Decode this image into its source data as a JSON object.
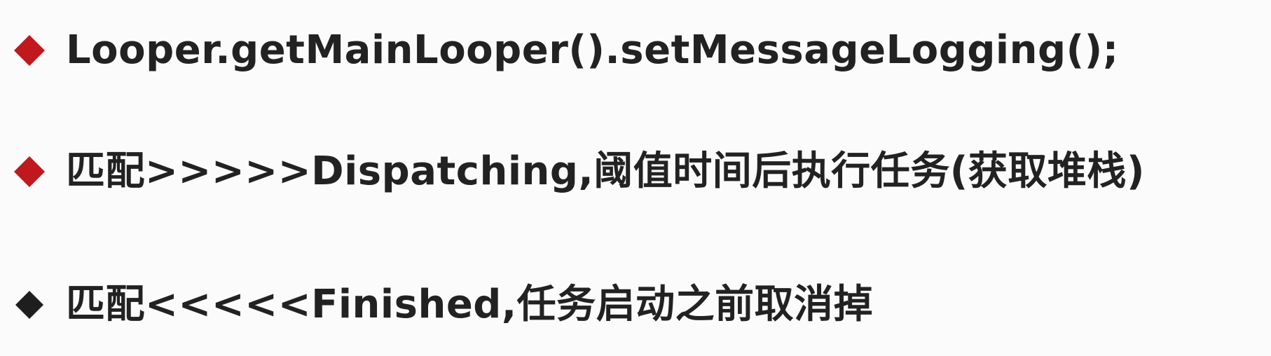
{
  "bullets": [
    {
      "text": "Looper.getMainLooper().setMessageLogging();",
      "marker_color": "#c0181c"
    },
    {
      "text": "匹配>>>>>Dispatching,阈值时间后执行任务(获取堆栈)",
      "marker_color": "#c0181c"
    },
    {
      "text": "匹配<<<<<Finished,任务启动之前取消掉",
      "marker_color": "#1e1e1e"
    }
  ],
  "icons": {
    "marker": "diamond-bullet-icon"
  },
  "colors": {
    "text": "#222222",
    "background": "#fbfbfb"
  }
}
